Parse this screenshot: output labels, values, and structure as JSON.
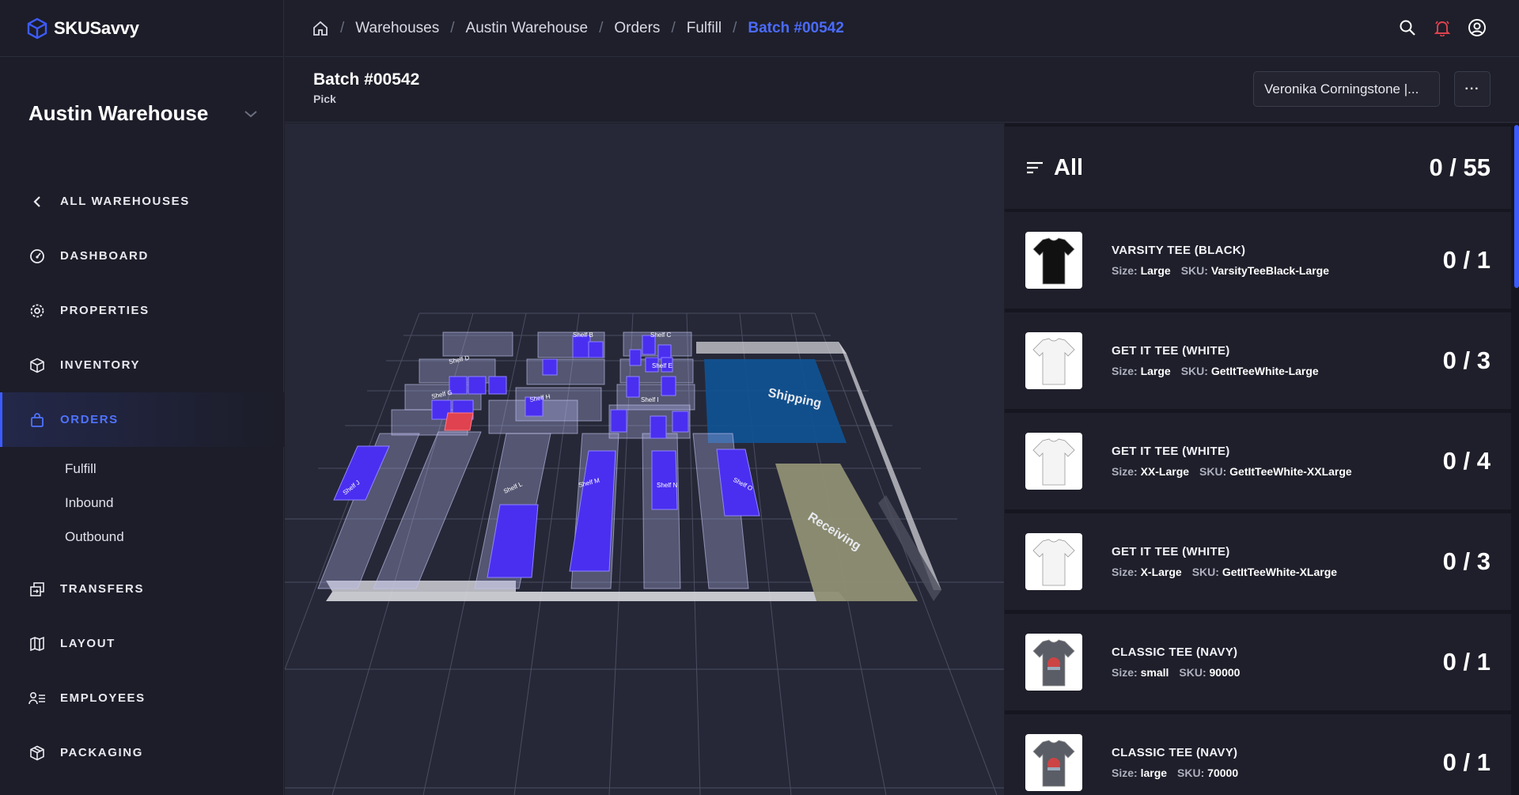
{
  "app": {
    "logo_text": "SKUSavvy"
  },
  "sidebar": {
    "warehouse_name": "Austin Warehouse",
    "nav": [
      {
        "label": "ALL WAREHOUSES",
        "icon": "chevron-left-icon"
      },
      {
        "label": "DASHBOARD",
        "icon": "gauge-icon"
      },
      {
        "label": "PROPERTIES",
        "icon": "gear-icon"
      },
      {
        "label": "INVENTORY",
        "icon": "box-icon"
      },
      {
        "label": "ORDERS",
        "icon": "bag-icon"
      },
      {
        "label": "TRANSFERS",
        "icon": "transfer-icon"
      },
      {
        "label": "LAYOUT",
        "icon": "map-icon"
      },
      {
        "label": "EMPLOYEES",
        "icon": "employees-icon"
      },
      {
        "label": "PACKAGING",
        "icon": "package-icon"
      }
    ],
    "orders_sub": [
      "Fulfill",
      "Inbound",
      "Outbound"
    ]
  },
  "breadcrumb": [
    "Warehouses",
    "Austin Warehouse",
    "Orders",
    "Fulfill",
    "Batch #00542"
  ],
  "header": {
    "title": "Batch #00542",
    "subtitle": "Pick",
    "assignee": "Veronika Corningstone |...",
    "more_label": "···"
  },
  "map": {
    "zones": [
      "Shipping",
      "Receiving"
    ],
    "shelves": [
      "Shelf B",
      "Shelf C",
      "Shelf D",
      "Shelf E",
      "Shelf G",
      "Shelf H",
      "Shelf I",
      "Shelf J",
      "Shelf L",
      "Shelf M",
      "Shelf N",
      "Shelf O"
    ],
    "colors": {
      "floor": "#2a2c3c",
      "shelf": "#b9b6ee",
      "stock": "#4a2ff0",
      "highlight": "#e0424f",
      "shipping": "#0f5294",
      "receiving": "#8f8f73"
    }
  },
  "picklist": {
    "filter_label": "All",
    "total": "0 / 55",
    "items": [
      {
        "name": "VARSITY TEE (BLACK)",
        "size_label": "Size:",
        "size": "Large",
        "sku_label": "SKU:",
        "sku": "VarsityTeeBlack-Large",
        "count": "0 / 1",
        "shirt_color": "#111111"
      },
      {
        "name": "GET IT TEE (WHITE)",
        "size_label": "Size:",
        "size": "Large",
        "sku_label": "SKU:",
        "sku": "GetItTeeWhite-Large",
        "count": "0 / 3",
        "shirt_color": "#f4f4f4"
      },
      {
        "name": "GET IT TEE (WHITE)",
        "size_label": "Size:",
        "size": "XX-Large",
        "sku_label": "SKU:",
        "sku": "GetItTeeWhite-XXLarge",
        "count": "0 / 4",
        "shirt_color": "#f4f4f4"
      },
      {
        "name": "GET IT TEE (WHITE)",
        "size_label": "Size:",
        "size": "X-Large",
        "sku_label": "SKU:",
        "sku": "GetItTeeWhite-XLarge",
        "count": "0 / 3",
        "shirt_color": "#f4f4f4"
      },
      {
        "name": "CLASSIC TEE (NAVY)",
        "size_label": "Size:",
        "size": "small",
        "sku_label": "SKU:",
        "sku": "90000",
        "count": "0 / 1",
        "shirt_color": "#5a5d66"
      },
      {
        "name": "CLASSIC TEE (NAVY)",
        "size_label": "Size:",
        "size": "large",
        "sku_label": "SKU:",
        "sku": "70000",
        "count": "0 / 1",
        "shirt_color": "#5a5d66"
      }
    ]
  }
}
